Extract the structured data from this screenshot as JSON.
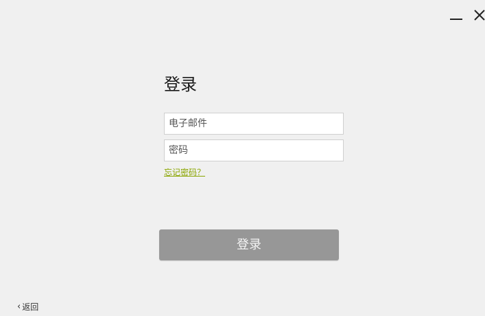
{
  "window_controls": {
    "minimize_icon": "minimize-icon",
    "close_icon": "close-icon"
  },
  "login": {
    "title": "登录",
    "email_placeholder": "电子邮件",
    "email_value": "",
    "password_placeholder": "密码",
    "password_value": "",
    "forgot_label": "忘记密码？",
    "submit_label": "登录"
  },
  "footer": {
    "back_label": "返回",
    "back_icon": "chevron-left-icon"
  },
  "colors": {
    "background": "#f0f0f0",
    "link": "#8aa500",
    "button": "#979797"
  }
}
